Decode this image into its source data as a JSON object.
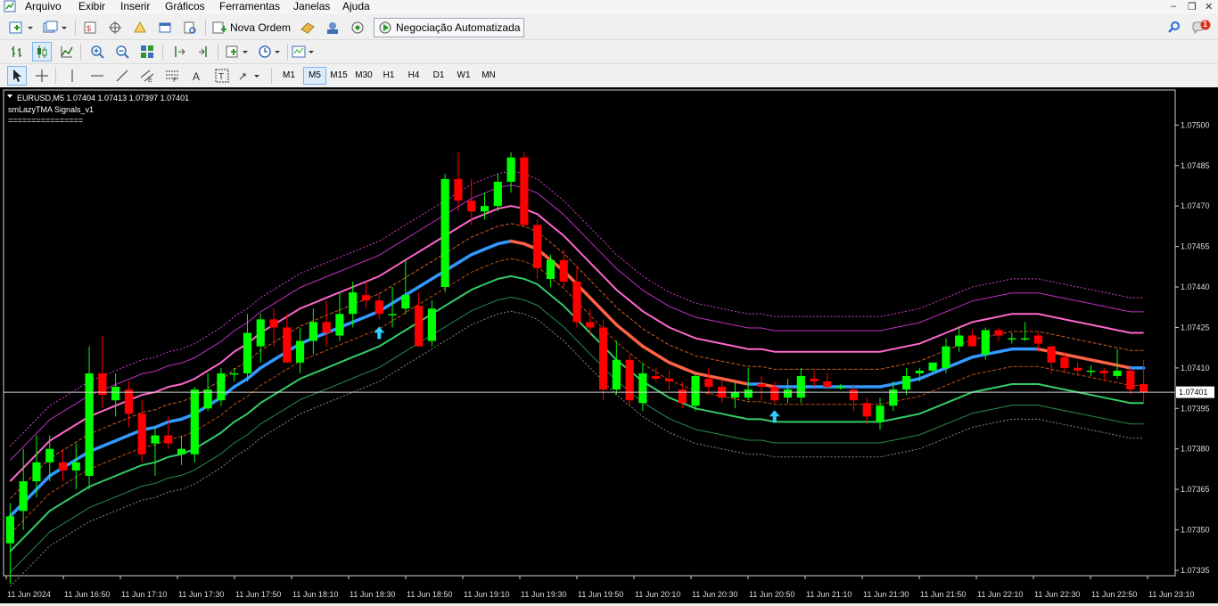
{
  "menu": {
    "items": [
      "Arquivo",
      "Exibir",
      "Inserir",
      "Gráficos",
      "Ferramentas",
      "Janelas",
      "Ajuda"
    ]
  },
  "toolbar": {
    "new_order_label": "Nova Ordem",
    "autotrading_label": "Negociação Automatizada",
    "notification_count": "1"
  },
  "timeframes": [
    "M1",
    "M5",
    "M15",
    "M30",
    "H1",
    "H4",
    "D1",
    "W1",
    "MN"
  ],
  "active_timeframe": "M5",
  "chart": {
    "header": "EURUSD,M5  1.07404 1.07413 1.07397 1.07401",
    "indicator_name": "smLazyTMA Signals_v1",
    "indicator_line": "================",
    "current_price": "1.07401",
    "colors": {
      "up": "#00ff00",
      "down": "#ff0000",
      "tma_up": "#3399ff",
      "tma_down": "#ff6347",
      "band1": "#ff66cc",
      "band2": "#33cc66"
    }
  },
  "chart_data": {
    "type": "candlestick",
    "y_ticks": [
      "1.07500",
      "1.07485",
      "1.07470",
      "1.07455",
      "1.07440",
      "1.07425",
      "1.07410",
      "1.07395",
      "1.07380",
      "1.07365",
      "1.07350",
      "1.07335"
    ],
    "y_tick_values": [
      1.075,
      1.07485,
      1.0747,
      1.07455,
      1.0744,
      1.07425,
      1.0741,
      1.07395,
      1.0738,
      1.07365,
      1.0735,
      1.07335
    ],
    "ylim": [
      1.07333,
      1.07513
    ],
    "x_ticks": [
      "11 Jun 2024",
      "11 Jun 16:50",
      "11 Jun 17:10",
      "11 Jun 17:30",
      "11 Jun 17:50",
      "11 Jun 18:10",
      "11 Jun 18:30",
      "11 Jun 18:50",
      "11 Jun 19:10",
      "11 Jun 19:30",
      "11 Jun 19:50",
      "11 Jun 20:10",
      "11 Jun 20:30",
      "11 Jun 20:50",
      "11 Jun 21:10",
      "11 Jun 21:30",
      "11 Jun 21:50",
      "11 Jun 22:10",
      "11 Jun 22:30",
      "11 Jun 22:50",
      "11 Jun 23:10"
    ],
    "candles": [
      {
        "o": 1.07345,
        "h": 1.0736,
        "l": 1.0733,
        "c": 1.07355
      },
      {
        "o": 1.07357,
        "h": 1.0738,
        "l": 1.0735,
        "c": 1.07368
      },
      {
        "o": 1.07368,
        "h": 1.07385,
        "l": 1.07362,
        "c": 1.07375
      },
      {
        "o": 1.07375,
        "h": 1.07385,
        "l": 1.07368,
        "c": 1.0738
      },
      {
        "o": 1.07375,
        "h": 1.0738,
        "l": 1.07368,
        "c": 1.07372
      },
      {
        "o": 1.07372,
        "h": 1.07382,
        "l": 1.07365,
        "c": 1.07375
      },
      {
        "o": 1.0737,
        "h": 1.07418,
        "l": 1.07365,
        "c": 1.07408
      },
      {
        "o": 1.07408,
        "h": 1.07422,
        "l": 1.07395,
        "c": 1.074
      },
      {
        "o": 1.07398,
        "h": 1.07408,
        "l": 1.07392,
        "c": 1.07403
      },
      {
        "o": 1.07402,
        "h": 1.07405,
        "l": 1.07388,
        "c": 1.07393
      },
      {
        "o": 1.07393,
        "h": 1.07398,
        "l": 1.07375,
        "c": 1.07378
      },
      {
        "o": 1.07382,
        "h": 1.07388,
        "l": 1.0737,
        "c": 1.07385
      },
      {
        "o": 1.07385,
        "h": 1.07392,
        "l": 1.0738,
        "c": 1.07382
      },
      {
        "o": 1.07378,
        "h": 1.07385,
        "l": 1.07374,
        "c": 1.0738
      },
      {
        "o": 1.07378,
        "h": 1.07403,
        "l": 1.07375,
        "c": 1.07402
      },
      {
        "o": 1.07395,
        "h": 1.07408,
        "l": 1.07394,
        "c": 1.07402
      },
      {
        "o": 1.07398,
        "h": 1.0741,
        "l": 1.07396,
        "c": 1.07408
      },
      {
        "o": 1.07408,
        "h": 1.0741,
        "l": 1.07405,
        "c": 1.07408
      },
      {
        "o": 1.07408,
        "h": 1.0743,
        "l": 1.07405,
        "c": 1.07423
      },
      {
        "o": 1.07418,
        "h": 1.0743,
        "l": 1.07412,
        "c": 1.07428
      },
      {
        "o": 1.07428,
        "h": 1.07432,
        "l": 1.07418,
        "c": 1.07425
      },
      {
        "o": 1.07425,
        "h": 1.0743,
        "l": 1.07412,
        "c": 1.07412
      },
      {
        "o": 1.07412,
        "h": 1.07425,
        "l": 1.07408,
        "c": 1.0742
      },
      {
        "o": 1.0742,
        "h": 1.07432,
        "l": 1.07415,
        "c": 1.07427
      },
      {
        "o": 1.07427,
        "h": 1.07435,
        "l": 1.07418,
        "c": 1.07423
      },
      {
        "o": 1.07422,
        "h": 1.07438,
        "l": 1.0742,
        "c": 1.0743
      },
      {
        "o": 1.0743,
        "h": 1.07442,
        "l": 1.07425,
        "c": 1.07438
      },
      {
        "o": 1.07437,
        "h": 1.07442,
        "l": 1.07432,
        "c": 1.07435
      },
      {
        "o": 1.07435,
        "h": 1.07438,
        "l": 1.07428,
        "c": 1.0743
      },
      {
        "o": 1.0743,
        "h": 1.0744,
        "l": 1.07425,
        "c": 1.0743
      },
      {
        "o": 1.07432,
        "h": 1.0745,
        "l": 1.0743,
        "c": 1.07437
      },
      {
        "o": 1.07433,
        "h": 1.07438,
        "l": 1.07418,
        "c": 1.07418
      },
      {
        "o": 1.0742,
        "h": 1.07435,
        "l": 1.07418,
        "c": 1.07432
      },
      {
        "o": 1.0744,
        "h": 1.07482,
        "l": 1.07438,
        "c": 1.0748
      },
      {
        "o": 1.0748,
        "h": 1.0749,
        "l": 1.07468,
        "c": 1.07472
      },
      {
        "o": 1.07472,
        "h": 1.0748,
        "l": 1.07463,
        "c": 1.07468
      },
      {
        "o": 1.07468,
        "h": 1.07475,
        "l": 1.07465,
        "c": 1.0747
      },
      {
        "o": 1.0747,
        "h": 1.07482,
        "l": 1.07468,
        "c": 1.07479
      },
      {
        "o": 1.07479,
        "h": 1.0749,
        "l": 1.07475,
        "c": 1.07488
      },
      {
        "o": 1.07488,
        "h": 1.0749,
        "l": 1.07462,
        "c": 1.07463
      },
      {
        "o": 1.07463,
        "h": 1.07465,
        "l": 1.07443,
        "c": 1.07447
      },
      {
        "o": 1.07443,
        "h": 1.07452,
        "l": 1.0744,
        "c": 1.0745
      },
      {
        "o": 1.0745,
        "h": 1.07454,
        "l": 1.0744,
        "c": 1.07442
      },
      {
        "o": 1.07442,
        "h": 1.07448,
        "l": 1.07425,
        "c": 1.07427
      },
      {
        "o": 1.07427,
        "h": 1.07432,
        "l": 1.07422,
        "c": 1.07425
      },
      {
        "o": 1.07425,
        "h": 1.07428,
        "l": 1.07398,
        "c": 1.07402
      },
      {
        "o": 1.07402,
        "h": 1.0742,
        "l": 1.074,
        "c": 1.07413
      },
      {
        "o": 1.07413,
        "h": 1.07415,
        "l": 1.07396,
        "c": 1.07398
      },
      {
        "o": 1.07397,
        "h": 1.07412,
        "l": 1.07394,
        "c": 1.07408
      },
      {
        "o": 1.07407,
        "h": 1.0741,
        "l": 1.07405,
        "c": 1.07406
      },
      {
        "o": 1.07406,
        "h": 1.07409,
        "l": 1.07402,
        "c": 1.07405
      },
      {
        "o": 1.07402,
        "h": 1.07405,
        "l": 1.07395,
        "c": 1.07397
      },
      {
        "o": 1.07396,
        "h": 1.07408,
        "l": 1.07394,
        "c": 1.07407
      },
      {
        "o": 1.07406,
        "h": 1.0741,
        "l": 1.074,
        "c": 1.07403
      },
      {
        "o": 1.07403,
        "h": 1.07406,
        "l": 1.07397,
        "c": 1.07399
      },
      {
        "o": 1.07399,
        "h": 1.07405,
        "l": 1.07395,
        "c": 1.07401
      },
      {
        "o": 1.07399,
        "h": 1.0741,
        "l": 1.07398,
        "c": 1.07402
      },
      {
        "o": 1.07404,
        "h": 1.07407,
        "l": 1.07398,
        "c": 1.07403
      },
      {
        "o": 1.07403,
        "h": 1.07405,
        "l": 1.07397,
        "c": 1.07398
      },
      {
        "o": 1.07399,
        "h": 1.07406,
        "l": 1.07397,
        "c": 1.07402
      },
      {
        "o": 1.07399,
        "h": 1.0741,
        "l": 1.07397,
        "c": 1.07407
      },
      {
        "o": 1.07406,
        "h": 1.07409,
        "l": 1.07403,
        "c": 1.07405
      },
      {
        "o": 1.07405,
        "h": 1.07408,
        "l": 1.07402,
        "c": 1.07403
      },
      {
        "o": 1.07403,
        "h": 1.07404,
        "l": 1.07402,
        "c": 1.07403
      },
      {
        "o": 1.07402,
        "h": 1.07404,
        "l": 1.07394,
        "c": 1.07398
      },
      {
        "o": 1.07397,
        "h": 1.07399,
        "l": 1.07389,
        "c": 1.07392
      },
      {
        "o": 1.0739,
        "h": 1.07399,
        "l": 1.07387,
        "c": 1.07396
      },
      {
        "o": 1.07396,
        "h": 1.07405,
        "l": 1.07394,
        "c": 1.07402
      },
      {
        "o": 1.07402,
        "h": 1.0741,
        "l": 1.074,
        "c": 1.07407
      },
      {
        "o": 1.07408,
        "h": 1.0741,
        "l": 1.07405,
        "c": 1.07409
      },
      {
        "o": 1.07409,
        "h": 1.07412,
        "l": 1.07408,
        "c": 1.07412
      },
      {
        "o": 1.0741,
        "h": 1.07421,
        "l": 1.07408,
        "c": 1.07418
      },
      {
        "o": 1.07418,
        "h": 1.07425,
        "l": 1.07416,
        "c": 1.07422
      },
      {
        "o": 1.07422,
        "h": 1.07424,
        "l": 1.07418,
        "c": 1.07418
      },
      {
        "o": 1.07415,
        "h": 1.07425,
        "l": 1.07413,
        "c": 1.07424
      },
      {
        "o": 1.07424,
        "h": 1.07425,
        "l": 1.0742,
        "c": 1.07422
      },
      {
        "o": 1.07421,
        "h": 1.07423,
        "l": 1.07419,
        "c": 1.07421
      },
      {
        "o": 1.07421,
        "h": 1.07427,
        "l": 1.0742,
        "c": 1.07421
      },
      {
        "o": 1.07422,
        "h": 1.07423,
        "l": 1.07416,
        "c": 1.07419
      },
      {
        "o": 1.07418,
        "h": 1.07418,
        "l": 1.07408,
        "c": 1.07412
      },
      {
        "o": 1.07414,
        "h": 1.07416,
        "l": 1.07408,
        "c": 1.0741
      },
      {
        "o": 1.0741,
        "h": 1.07412,
        "l": 1.07407,
        "c": 1.07409
      },
      {
        "o": 1.07409,
        "h": 1.07411,
        "l": 1.07407,
        "c": 1.07409
      },
      {
        "o": 1.07409,
        "h": 1.0741,
        "l": 1.07405,
        "c": 1.07408
      },
      {
        "o": 1.07407,
        "h": 1.07417,
        "l": 1.07406,
        "c": 1.07409
      },
      {
        "o": 1.07409,
        "h": 1.0741,
        "l": 1.074,
        "c": 1.07402
      },
      {
        "o": 1.07404,
        "h": 1.07413,
        "l": 1.07397,
        "c": 1.07401
      }
    ],
    "tma": [
      1.07355,
      1.0736,
      1.07365,
      1.0737,
      1.07373,
      1.07376,
      1.07379,
      1.07381,
      1.07383,
      1.07385,
      1.07387,
      1.07388,
      1.0739,
      1.07391,
      1.07393,
      1.07396,
      1.07399,
      1.07403,
      1.07406,
      1.0741,
      1.07413,
      1.07416,
      1.07419,
      1.07421,
      1.07423,
      1.07425,
      1.07427,
      1.07429,
      1.07431,
      1.07434,
      1.07437,
      1.0744,
      1.07443,
      1.07446,
      1.07449,
      1.07452,
      1.07454,
      1.07456,
      1.07457,
      1.07456,
      1.07454,
      1.0745,
      1.07446,
      1.07441,
      1.07436,
      1.07431,
      1.07426,
      1.07422,
      1.07418,
      1.07415,
      1.07412,
      1.0741,
      1.07408,
      1.07407,
      1.07406,
      1.07405,
      1.07404,
      1.07404,
      1.07403,
      1.07403,
      1.07403,
      1.07403,
      1.07403,
      1.07403,
      1.07403,
      1.07403,
      1.07403,
      1.07404,
      1.07405,
      1.07406,
      1.07408,
      1.0741,
      1.07412,
      1.07414,
      1.07415,
      1.07416,
      1.07417,
      1.07417,
      1.07417,
      1.07416,
      1.07415,
      1.07414,
      1.07413,
      1.07412,
      1.07411,
      1.0741,
      1.0741
    ],
    "band_offset_inner": 0.00013,
    "band_offset_outer": 0.00026,
    "signals": [
      {
        "index": 28,
        "dir": "up"
      },
      {
        "index": 58,
        "dir": "up"
      }
    ]
  }
}
